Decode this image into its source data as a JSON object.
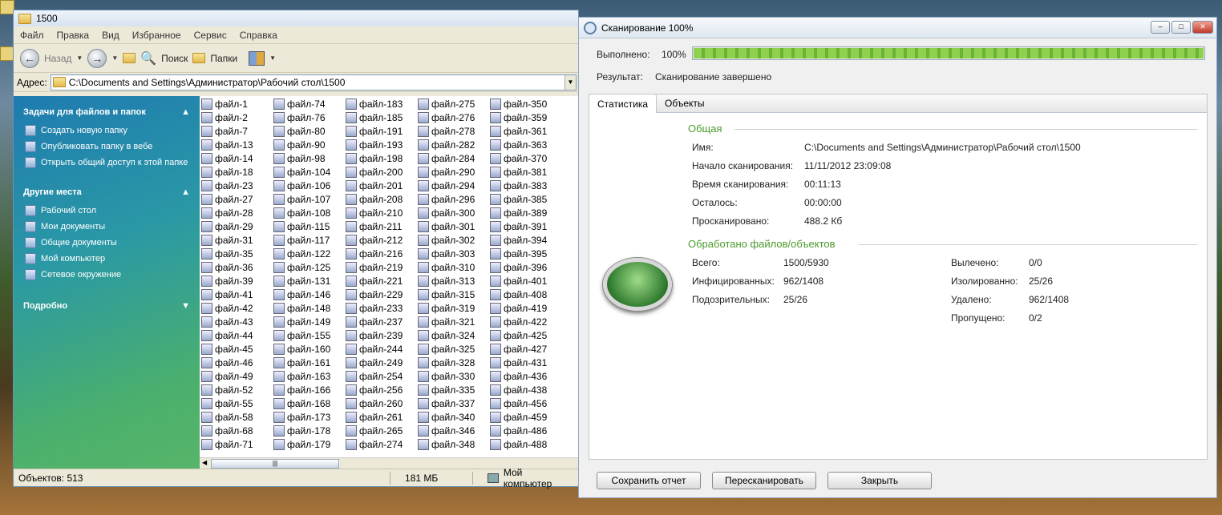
{
  "explorer": {
    "title": "1500",
    "menu": [
      "Файл",
      "Правка",
      "Вид",
      "Избранное",
      "Сервис",
      "Справка"
    ],
    "toolbar": {
      "back": "Назад",
      "search": "Поиск",
      "folders": "Папки"
    },
    "address_label": "Адрес:",
    "address": "C:\\Documents and Settings\\Администратор\\Рабочий стол\\1500",
    "tasks": {
      "file_tasks_title": "Задачи для файлов и папок",
      "file_tasks": [
        "Создать новую папку",
        "Опубликовать папку в вебе",
        "Открыть общий доступ к этой папке"
      ],
      "other_places_title": "Другие места",
      "other_places": [
        "Рабочий стол",
        "Мои документы",
        "Общие документы",
        "Мой компьютер",
        "Сетевое окружение"
      ],
      "details_title": "Подробно"
    },
    "files": [
      [
        "файл-1",
        "файл-2",
        "файл-7",
        "файл-13",
        "файл-14",
        "файл-18",
        "файл-23",
        "файл-27",
        "файл-28",
        "файл-29",
        "файл-31",
        "файл-35",
        "файл-36",
        "файл-39",
        "файл-41",
        "файл-42",
        "файл-43",
        "файл-44",
        "файл-45",
        "файл-46",
        "файл-49",
        "файл-52",
        "файл-55",
        "файл-58",
        "файл-68",
        "файл-71"
      ],
      [
        "файл-74",
        "файл-76",
        "файл-80",
        "файл-90",
        "файл-98",
        "файл-104",
        "файл-106",
        "файл-107",
        "файл-108",
        "файл-115",
        "файл-117",
        "файл-122",
        "файл-125",
        "файл-131",
        "файл-146",
        "файл-148",
        "файл-149",
        "файл-155",
        "файл-160",
        "файл-161",
        "файл-163",
        "файл-166",
        "файл-168",
        "файл-173",
        "файл-178",
        "файл-179"
      ],
      [
        "файл-183",
        "файл-185",
        "файл-191",
        "файл-193",
        "файл-198",
        "файл-200",
        "файл-201",
        "файл-208",
        "файл-210",
        "файл-211",
        "файл-212",
        "файл-216",
        "файл-219",
        "файл-221",
        "файл-229",
        "файл-233",
        "файл-237",
        "файл-239",
        "файл-244",
        "файл-249",
        "файл-254",
        "файл-256",
        "файл-260",
        "файл-261",
        "файл-265",
        "файл-274"
      ],
      [
        "файл-275",
        "файл-276",
        "файл-278",
        "файл-282",
        "файл-284",
        "файл-290",
        "файл-294",
        "файл-296",
        "файл-300",
        "файл-301",
        "файл-302",
        "файл-303",
        "файл-310",
        "файл-313",
        "файл-315",
        "файл-319",
        "файл-321",
        "файл-324",
        "файл-325",
        "файл-328",
        "файл-330",
        "файл-335",
        "файл-337",
        "файл-340",
        "файл-346",
        "файл-348"
      ],
      [
        "файл-350",
        "файл-359",
        "файл-361",
        "файл-363",
        "файл-370",
        "файл-381",
        "файл-383",
        "файл-385",
        "файл-389",
        "файл-391",
        "файл-394",
        "файл-395",
        "файл-396",
        "файл-401",
        "файл-408",
        "файл-419",
        "файл-422",
        "файл-425",
        "файл-427",
        "файл-431",
        "файл-436",
        "файл-438",
        "файл-456",
        "файл-459",
        "файл-486",
        "файл-488"
      ]
    ],
    "status": {
      "objects": "Объектов: 513",
      "size": "181 МБ",
      "location": "Мой компьютер"
    }
  },
  "scan": {
    "title": "Сканирование 100%",
    "done_label": "Выполнено:",
    "done_value": "100%",
    "progress": 1.0,
    "result_label": "Результат:",
    "result_value": "Сканирование завершено",
    "tabs": [
      "Статистика",
      "Объекты"
    ],
    "general_title": "Общая",
    "general": [
      {
        "label": "Имя:",
        "value": "C:\\Documents and Settings\\Администратор\\Рабочий стол\\1500"
      },
      {
        "label": "Начало сканирования:",
        "value": "11/11/2012 23:09:08"
      },
      {
        "label": "Время сканирования:",
        "value": "00:11:13"
      },
      {
        "label": "Осталось:",
        "value": "00:00:00"
      },
      {
        "label": "Просканировано:",
        "value": "488.2 Кб"
      }
    ],
    "processed_title": "Обработано файлов/объектов",
    "processed_left": [
      {
        "label": "Всего:",
        "value": "1500/5930"
      },
      {
        "label": "Инфицированных:",
        "value": "962/1408"
      },
      {
        "label": "Подозрительных:",
        "value": "25/26"
      }
    ],
    "processed_right": [
      {
        "label": "Вылечено:",
        "value": "0/0"
      },
      {
        "label": "Изолированно:",
        "value": "25/26"
      },
      {
        "label": "Удалено:",
        "value": "962/1408"
      },
      {
        "label": "Пропущено:",
        "value": "0/2"
      }
    ],
    "buttons": {
      "save": "Сохранить отчет",
      "rescan": "Пересканировать",
      "close": "Закрыть"
    }
  }
}
